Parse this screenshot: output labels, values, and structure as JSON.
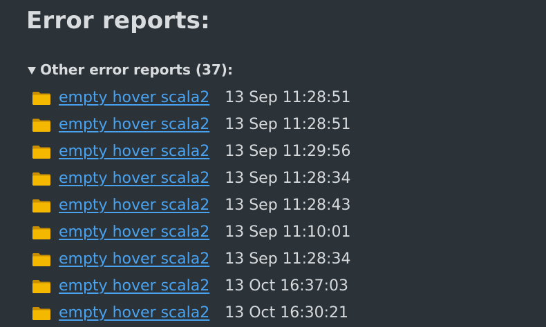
{
  "page": {
    "title": "Error reports:"
  },
  "section": {
    "header": "Other error reports (37):",
    "expanded": true
  },
  "reports": [
    {
      "name": "empty hover scala2",
      "time": "13 Sep 11:28:51"
    },
    {
      "name": "empty hover scala2",
      "time": "13 Sep 11:28:51"
    },
    {
      "name": "empty hover scala2",
      "time": "13 Sep 11:29:56"
    },
    {
      "name": "empty hover scala2",
      "time": "13 Sep 11:28:34"
    },
    {
      "name": "empty hover scala2",
      "time": "13 Sep 11:28:43"
    },
    {
      "name": "empty hover scala2",
      "time": "13 Sep 11:10:01"
    },
    {
      "name": "empty hover scala2",
      "time": "13 Sep 11:28:34"
    },
    {
      "name": "empty hover scala2",
      "time": "13 Oct 16:37:03"
    },
    {
      "name": "empty hover scala2",
      "time": "13 Oct 16:30:21"
    }
  ],
  "colors": {
    "background": "#2b3238",
    "link": "#4aa3f0",
    "folder": "#f5b800",
    "text": "#d7dadc"
  },
  "icons": {
    "report_item": "folder-icon",
    "section_toggle": "triangle-down-icon"
  }
}
